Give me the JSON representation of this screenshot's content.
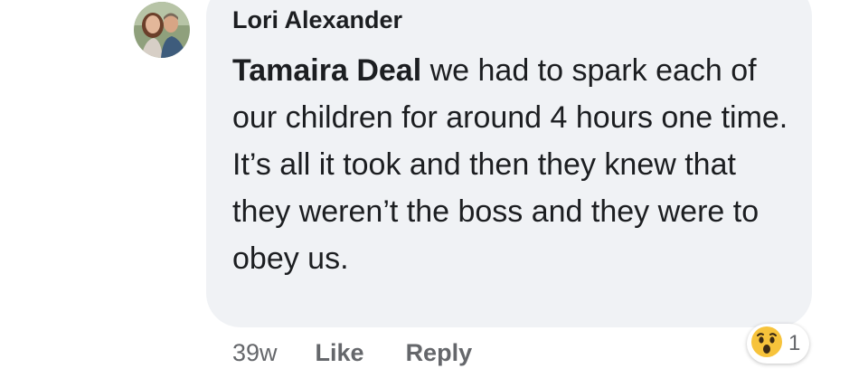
{
  "comment": {
    "author": "Lori Alexander",
    "mention": "Tamaira Deal",
    "text": " we had to spark each of our children for around 4 hours one time. It’s all it took and then they knew that they weren’t the boss and they were to obey us.",
    "timestamp": "39w",
    "like_label": "Like",
    "reply_label": "Reply"
  },
  "reaction": {
    "icon": "wow-emoji-icon",
    "count": "1"
  },
  "colors": {
    "bubble": "#f0f2f5",
    "text": "#1c1e21",
    "secondary_text": "#65676b",
    "emoji": "#f7c33b"
  }
}
